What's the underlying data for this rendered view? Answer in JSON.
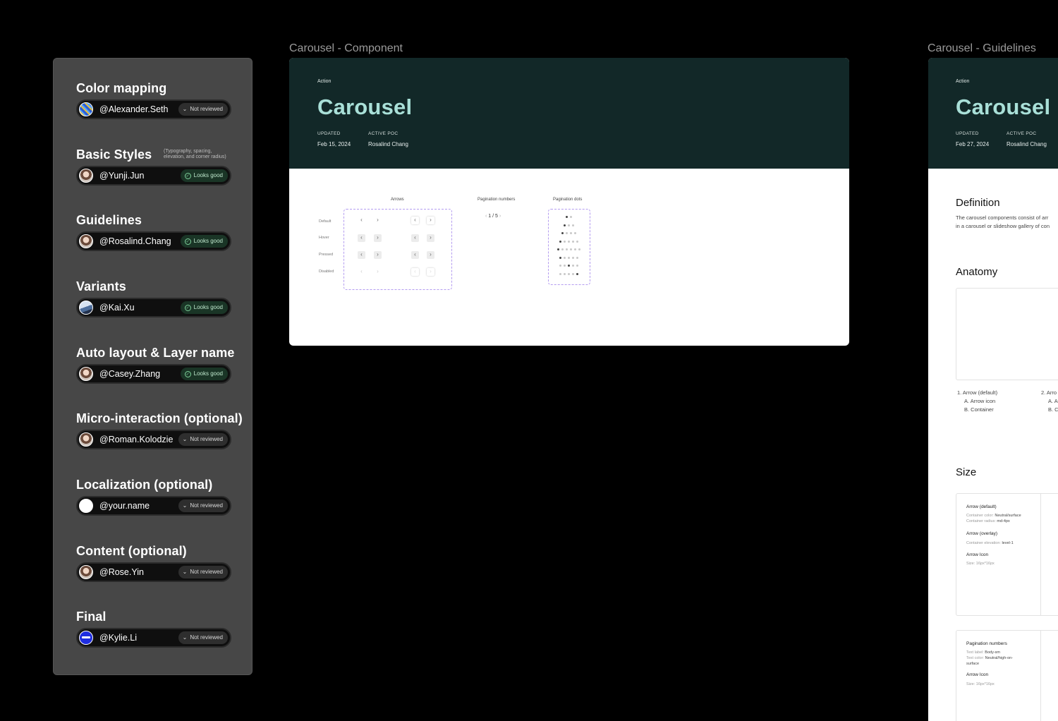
{
  "review_panel": {
    "sections": [
      {
        "title": "Color mapping",
        "user": "@Alexander.Seth",
        "status": "Not reviewed",
        "status_type": "not-reviewed",
        "avatar": "striped"
      },
      {
        "title": "Basic Styles",
        "note": "(Typography, spacing, elevation, and corner radius)",
        "user": "@Yunji.Jun",
        "status": "Looks good",
        "status_type": "looks-good",
        "avatar": "photo"
      },
      {
        "title": "Guidelines",
        "user": "@Rosalind.Chang",
        "status": "Looks good",
        "status_type": "looks-good",
        "avatar": "photo"
      },
      {
        "title": "Variants",
        "user": "@Kai.Xu",
        "status": "Looks good",
        "status_type": "looks-good",
        "avatar": "mountain"
      },
      {
        "title": "Auto layout & Layer name",
        "user": "@Casey.Zhang",
        "status": "Looks good",
        "status_type": "looks-good",
        "avatar": "photo"
      },
      {
        "title": "Micro-interaction (optional)",
        "user": "@Roman.Kolodzie",
        "status": "Not reviewed",
        "status_type": "not-reviewed",
        "avatar": "photo"
      },
      {
        "title": "Localization (optional)",
        "user": "@your.name",
        "status": "Not reviewed",
        "status_type": "not-reviewed",
        "avatar": "blank"
      },
      {
        "title": "Content (optional)",
        "user": "@Rose.Yin",
        "status": "Not reviewed",
        "status_type": "not-reviewed",
        "avatar": "photo"
      },
      {
        "title": "Final",
        "user": "@Kylie.Li",
        "status": "Not reviewed",
        "status_type": "not-reviewed",
        "avatar": "blue"
      }
    ]
  },
  "component_frame": {
    "label": "Carousel - Component",
    "header": {
      "category": "Action",
      "title": "Carousel",
      "updated_label": "UPDATED",
      "updated_value": "Feb 15, 2024",
      "poc_label": "ACTIVE POC",
      "poc_value": "Rosalind Chang"
    },
    "arrows": {
      "title": "Arrows",
      "rows": [
        "Default",
        "Hover",
        "Pressed",
        "Disabled"
      ]
    },
    "pagination_numbers": {
      "title": "Pagination numbers",
      "value": "1 / 5",
      "prev": "‹",
      "next": "›"
    },
    "pagination_dots": {
      "title": "Pagination dots"
    }
  },
  "guidelines_frame": {
    "label": "Carousel - Guidelines",
    "header": {
      "category": "Action",
      "title": "Carousel",
      "updated_label": "UPDATED",
      "updated_value": "Feb 27, 2024",
      "poc_label": "ACTIVE POC",
      "poc_value": "Rosalind Chang"
    },
    "definition": {
      "title": "Definition",
      "line1": "The carousel components consist of arr",
      "line2": "in a carousel or slideshow gallery of con"
    },
    "anatomy": {
      "title": "Anatomy",
      "col1": [
        "1. Arrow (default)",
        "A. Arrow icon",
        "B. Container"
      ],
      "col2": [
        "2. Arro",
        "A. A",
        "B. C"
      ]
    },
    "size": {
      "title": "Size",
      "card1": {
        "arrow_default": "Arrow (default)",
        "container_color_label": "Container color:",
        "container_color_value": "Neutral/surface",
        "container_radius_label": "Container radius:",
        "container_radius_value": "md-4px",
        "arrow_overlay": "Arrow (overlay)",
        "container_elevation_label": "Container elevation:",
        "container_elevation_value": "level-1",
        "arrow_icon": "Arrow Icon",
        "size_label": "Size:",
        "size_value": "16px*16px"
      },
      "card2": {
        "pagination_numbers": "Pagination numbers",
        "text_label_label": "Text label:",
        "text_label_value": "Body-sm",
        "text_color_label": "Text color:",
        "text_color_value": "Neutral/high-on-",
        "text_color_value2": "surface",
        "arrow_icon": "Arrow Icon",
        "size_label": "Size:",
        "size_value": "16px*16px"
      }
    }
  },
  "colors": {
    "canvas": "#000000",
    "panel": "#474747",
    "header_bg": "#122828",
    "header_title": "#a9e0d8",
    "looks_good_bg": "#1a3526",
    "looks_good_fg": "#7fd19b",
    "dashed_outline": "#b49cf0"
  }
}
